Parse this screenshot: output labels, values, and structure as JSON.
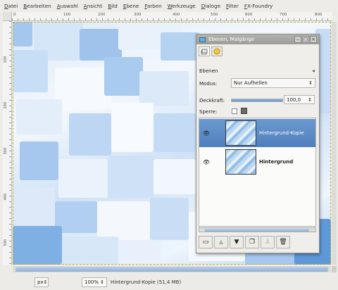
{
  "menubar": {
    "items": [
      "Datei",
      "Bearbeiten",
      "Auswahl",
      "Ansicht",
      "Bild",
      "Ebene",
      "Farben",
      "Werkzeuge",
      "Dialoge",
      "Filter",
      "FX-Foundry"
    ]
  },
  "ruler": {
    "h_ticks": [
      "0",
      "100",
      "200",
      "300",
      "400",
      "500",
      "600",
      "700",
      "800"
    ],
    "v_ticks": [
      "100",
      "200",
      "300",
      "400",
      "500"
    ]
  },
  "layers_dialog": {
    "title": "Ebenen, Malgänge",
    "section_label": "Ebenen",
    "mode_label": "Modus:",
    "mode_value": "Nur Aufhellen",
    "opacity_label": "Deckkraft:",
    "opacity_value": "100,0",
    "opacity_fraction": 1.0,
    "lock_label": "Sperre:",
    "layers": [
      {
        "name": "Hintergrund-Kopie",
        "selected": true,
        "visible": true
      },
      {
        "name": "Hintergrund",
        "selected": false,
        "visible": true
      }
    ],
    "toolbar_icons": [
      "new-layer-icon",
      "raise-layer-icon",
      "lower-layer-icon",
      "duplicate-layer-icon",
      "anchor-layer-icon",
      "delete-layer-icon"
    ]
  },
  "statusbar": {
    "unit": "px",
    "zoom": "100%",
    "info": "Hintergrund-Kopie (51,4 MB)"
  },
  "colors": {
    "selection_blue": "#5a8ac6",
    "canvas_blue": "#6aa3e0",
    "selection_border": "#c8b040"
  }
}
